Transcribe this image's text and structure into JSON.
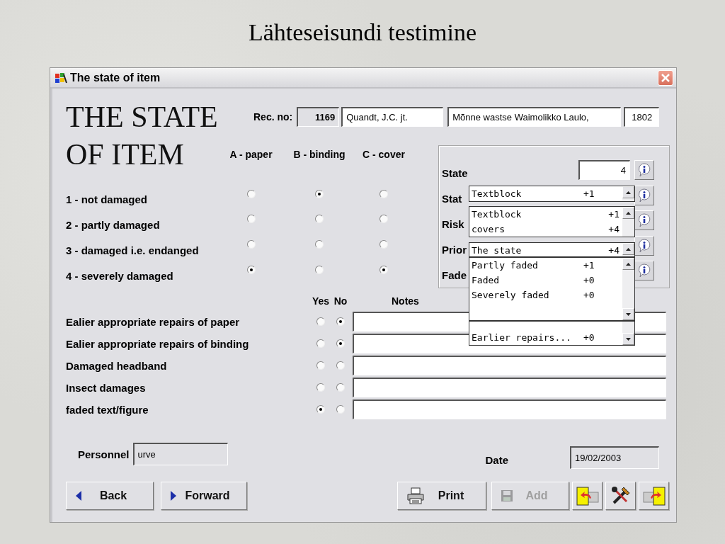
{
  "slide_title": "Lähteseisundi testimine",
  "window": {
    "title": "The state of item"
  },
  "heading_lines": [
    "THE STATE",
    "OF ITEM"
  ],
  "record": {
    "label": "Rec. no:",
    "number": "1169",
    "author": "Quandt, J.C. jt.",
    "book_title": "Mõnne wastse Waimolikko Laulo,",
    "year": "1802"
  },
  "damage": {
    "columns": [
      "A - paper",
      "B - binding",
      "C - cover"
    ],
    "rows": [
      {
        "label": "1 - not damaged",
        "choices": [
          {
            "selected": false
          },
          {
            "selected": true
          },
          {
            "selected": false
          }
        ]
      },
      {
        "label": "2 - partly damaged",
        "choices": [
          {
            "selected": false
          },
          {
            "selected": false
          },
          {
            "selected": false
          }
        ]
      },
      {
        "label": "3 - damaged i.e. endanged",
        "choices": [
          {
            "selected": false
          },
          {
            "selected": false
          },
          {
            "selected": false
          }
        ]
      },
      {
        "label": "4 - severely damaged",
        "choices": [
          {
            "selected": true
          },
          {
            "selected": false
          },
          {
            "selected": true
          }
        ]
      }
    ]
  },
  "assessment": {
    "labels": [
      "State",
      "Stat",
      "Risk",
      "Prior",
      "Fade"
    ],
    "state_value": "4"
  },
  "dropdowns": [
    {
      "kind": "list",
      "items": [
        {
          "name": "Textblock",
          "score": "+1"
        }
      ]
    },
    {
      "kind": "list",
      "items": [
        {
          "name": "Textblock",
          "score": "+1"
        },
        {
          "name": "covers",
          "score": "+4"
        }
      ]
    },
    {
      "kind": "combo",
      "value": {
        "name": "The state",
        "score": "+4"
      },
      "items": [
        {
          "name": "Partly faded",
          "score": "+1"
        },
        {
          "name": "Faded",
          "score": "+0"
        },
        {
          "name": "Severely faded",
          "score": "+0"
        }
      ]
    },
    {
      "kind": "list",
      "items": [
        {
          "name": "Earlier repairs...",
          "score": "+0"
        }
      ]
    }
  ],
  "conditions": {
    "headers": {
      "yes": "Yes",
      "no": "No",
      "notes": "Notes"
    },
    "rows": [
      {
        "label": "Ealier appropriate repairs of paper",
        "yes": false,
        "no": true
      },
      {
        "label": "Ealier appropriate repairs of binding",
        "yes": false,
        "no": true
      },
      {
        "label": "Damaged headband",
        "yes": false,
        "no": false
      },
      {
        "label": "Insect damages",
        "yes": false,
        "no": false
      },
      {
        "label": "faded text/figure",
        "yes": true,
        "no": false
      }
    ]
  },
  "personnel": {
    "label": "Personnel",
    "value": "urve"
  },
  "date": {
    "label": "Date",
    "value": "19/02/2003"
  },
  "buttons": [
    {
      "kind": "back",
      "label": "Back",
      "disabled": false
    },
    {
      "kind": "forward",
      "label": "Forward",
      "disabled": false
    },
    {
      "kind": "print",
      "label": "Print",
      "disabled": false
    },
    {
      "kind": "add",
      "label": "Add",
      "disabled": true
    },
    {
      "kind": "undo",
      "disabled": false
    },
    {
      "kind": "tools",
      "disabled": false
    },
    {
      "kind": "redo",
      "disabled": false
    }
  ]
}
